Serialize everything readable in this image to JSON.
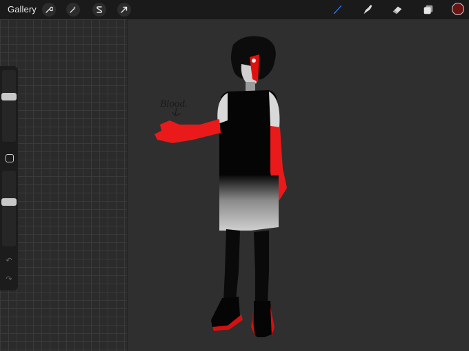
{
  "topbar": {
    "gallery_label": "Gallery",
    "left_tools": [
      "wrench-icon",
      "magic-wand-icon",
      "selection-icon",
      "transform-arrow-icon"
    ],
    "right_tools": [
      "brush-icon",
      "smudge-icon",
      "eraser-icon",
      "layers-icon"
    ],
    "active_tool": "brush-icon",
    "active_color": "#6a1313",
    "accent": "#2a7ff5"
  },
  "sidebar": {
    "brush_size_level": 0.35,
    "opacity_level": 0.6,
    "modify_button": "square-icon",
    "undo_icon": "undo-icon",
    "redo_icon": "redo-icon"
  },
  "canvas": {
    "annotation_text": "Blood."
  }
}
